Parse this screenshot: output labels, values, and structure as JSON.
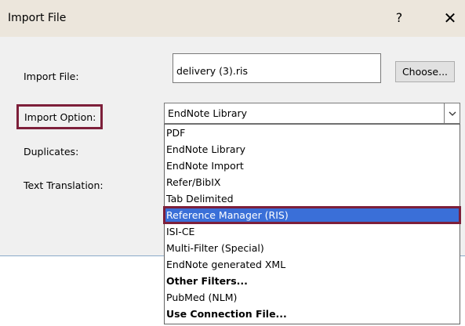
{
  "window": {
    "title": "Import File",
    "help_glyph": "?",
    "close_glyph": "✕"
  },
  "form": {
    "import_file_label": "Import File:",
    "import_option_label": "Import Option:",
    "duplicates_label": "Duplicates:",
    "text_translation_label": "Text Translation:",
    "file_value": "delivery (3).ris",
    "choose_label": "Choose...",
    "import_option_value": "EndNote Library"
  },
  "dropdown": {
    "options": [
      {
        "label": "PDF",
        "bold": false,
        "selected": false
      },
      {
        "label": "EndNote Library",
        "bold": false,
        "selected": false
      },
      {
        "label": "EndNote Import",
        "bold": false,
        "selected": false
      },
      {
        "label": "Refer/BibIX",
        "bold": false,
        "selected": false
      },
      {
        "label": "Tab Delimited",
        "bold": false,
        "selected": false
      },
      {
        "label": "Reference Manager (RIS)",
        "bold": false,
        "selected": true
      },
      {
        "label": "ISI-CE",
        "bold": false,
        "selected": false
      },
      {
        "label": "Multi-Filter (Special)",
        "bold": false,
        "selected": false
      },
      {
        "label": "EndNote generated XML",
        "bold": false,
        "selected": false
      },
      {
        "label": "Other Filters...",
        "bold": true,
        "selected": false
      },
      {
        "label": "PubMed (NLM)",
        "bold": false,
        "selected": false
      },
      {
        "label": "Use Connection File...",
        "bold": true,
        "selected": false
      }
    ]
  },
  "icons": {
    "dropdown_arrow": "chevron-down-icon"
  },
  "colors": {
    "highlight": "#3a6fd8",
    "annotation_border": "#7d1f3a",
    "titlebar": "#ece6dc"
  }
}
